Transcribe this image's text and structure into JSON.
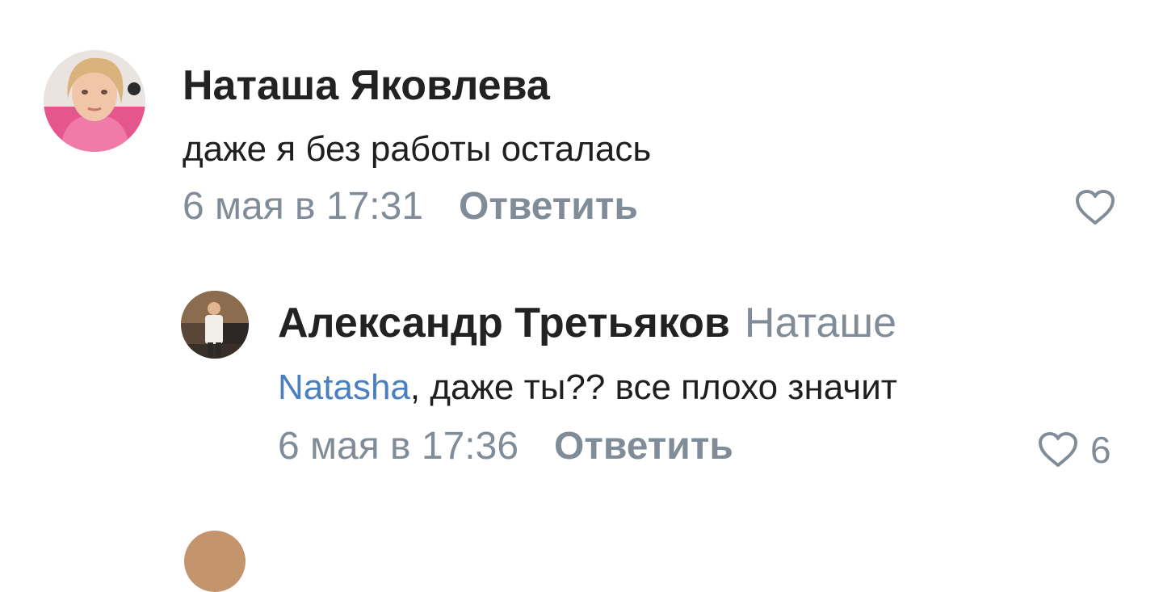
{
  "comments": [
    {
      "author": "Наташа Яковлева",
      "reply_to": "",
      "mention": "",
      "text": "даже я без работы осталась",
      "date": "6 мая в 17:31",
      "reply_label": "Ответить",
      "likes": "",
      "avatar_icon": "user-avatar-photo"
    },
    {
      "author": "Александр Третьяков",
      "reply_to": "Наташе",
      "mention": "Natasha",
      "text": ", даже ты?? все плохо значит",
      "date": "6 мая в 17:36",
      "reply_label": "Ответить",
      "likes": "6",
      "avatar_icon": "user-avatar-photo"
    }
  ],
  "icons": {
    "like": "heart-outline-icon"
  },
  "colors": {
    "author": "#222222",
    "text": "#1f1f1f",
    "meta": "#818c99",
    "mention": "#4a7fc1",
    "background": "#ffffff"
  }
}
